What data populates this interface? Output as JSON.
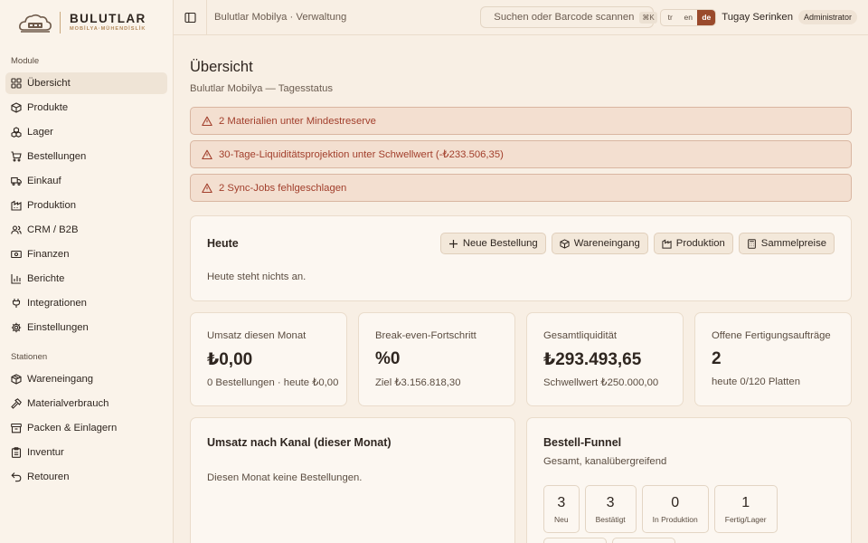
{
  "brand": {
    "name": "BULUTLAR",
    "subtitle": "MOBİLYA·MÜHENDİSLİK"
  },
  "sidebar": {
    "modules_label": "Module",
    "modules": [
      {
        "label": "Übersicht",
        "icon": "dashboard-icon",
        "active": true
      },
      {
        "label": "Produkte",
        "icon": "box-icon"
      },
      {
        "label": "Lager",
        "icon": "boxes-icon"
      },
      {
        "label": "Bestellungen",
        "icon": "cart-icon"
      },
      {
        "label": "Einkauf",
        "icon": "truck-icon"
      },
      {
        "label": "Produktion",
        "icon": "factory-icon"
      },
      {
        "label": "CRM / B2B",
        "icon": "users-icon"
      },
      {
        "label": "Finanzen",
        "icon": "banknote-icon"
      },
      {
        "label": "Berichte",
        "icon": "bar-chart-icon"
      },
      {
        "label": "Integrationen",
        "icon": "plug-icon"
      },
      {
        "label": "Einstellungen",
        "icon": "gear-icon"
      }
    ],
    "stations_label": "Stationen",
    "stations": [
      {
        "label": "Wareneingang",
        "icon": "package-icon"
      },
      {
        "label": "Materialverbrauch",
        "icon": "hammer-icon"
      },
      {
        "label": "Packen & Einlagern",
        "icon": "archive-icon"
      },
      {
        "label": "Inventur",
        "icon": "clipboard-icon"
      },
      {
        "label": "Retouren",
        "icon": "return-icon"
      }
    ]
  },
  "topbar": {
    "breadcrumb": "Bulutlar Mobilya · Verwaltung",
    "search_placeholder": "Suchen oder Barcode scannen",
    "search_shortcut": "⌘K",
    "languages": [
      "tr",
      "en",
      "de"
    ],
    "active_language": "de",
    "user_name": "Tugay Serinken",
    "user_role": "Administrator"
  },
  "page": {
    "title": "Übersicht",
    "subtitle": "Bulutlar Mobilya — Tagesstatus"
  },
  "alerts": [
    "2 Materialien unter Mindestreserve",
    "30-Tage-Liquiditätsprojektion unter Schwellwert (-₺233.506,35)",
    "2 Sync-Jobs fehlgeschlagen"
  ],
  "today": {
    "title": "Heute",
    "empty": "Heute steht nichts an.",
    "actions": [
      {
        "label": "Neue Bestellung",
        "icon": "plus-icon"
      },
      {
        "label": "Wareneingang",
        "icon": "package-icon"
      },
      {
        "label": "Produktion",
        "icon": "factory-icon"
      },
      {
        "label": "Sammelpreise",
        "icon": "calculator-icon"
      }
    ]
  },
  "kpis": [
    {
      "label": "Umsatz diesen Monat",
      "value": "₺0,00",
      "sub": "0 Bestellungen · heute ₺0,00"
    },
    {
      "label": "Break-even-Fortschritt",
      "value": "%0",
      "sub": "Ziel ₺3.156.818,30"
    },
    {
      "label": "Gesamtliquidität",
      "value": "₺293.493,65",
      "sub": "Schwellwert ₺250.000,00"
    },
    {
      "label": "Offene Fertigungsaufträge",
      "value": "2",
      "sub": "heute 0/120 Platten"
    }
  ],
  "channel": {
    "title": "Umsatz nach Kanal (dieser Monat)",
    "empty": "Diesen Monat keine Bestellungen."
  },
  "funnel": {
    "title": "Bestell-Funnel",
    "subtitle": "Gesamt, kanalübergreifend",
    "stages": [
      {
        "value": "3",
        "label": "Neu"
      },
      {
        "value": "3",
        "label": "Bestätigt"
      },
      {
        "value": "0",
        "label": "In Produktion"
      },
      {
        "value": "1",
        "label": "Fertig/Lager"
      }
    ]
  },
  "colors": {
    "accent": "#9a4a2c",
    "alert_text": "#a23f2c",
    "alert_bg": "#f3dfd0",
    "background": "#f8efe4"
  }
}
